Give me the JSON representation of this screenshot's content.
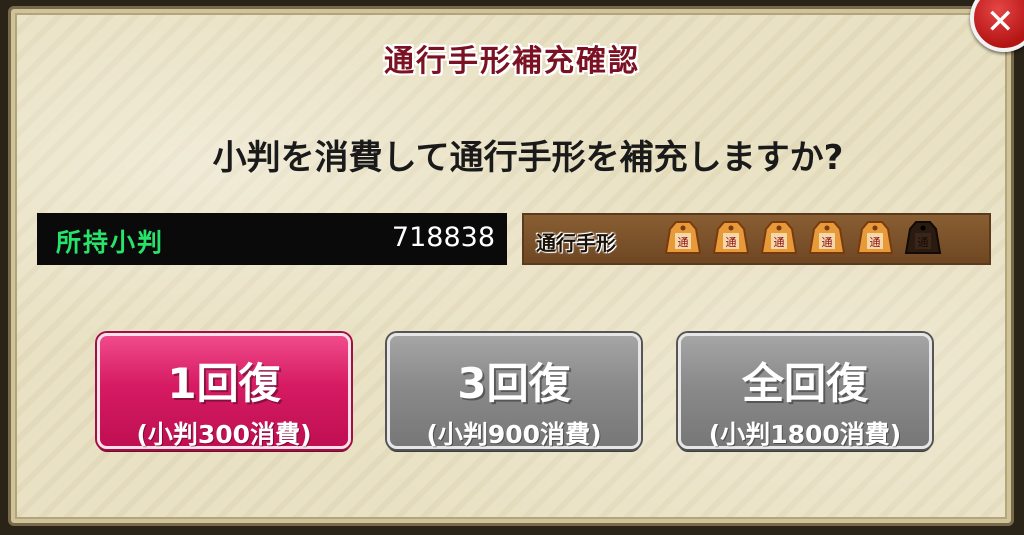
{
  "dialog": {
    "title": "通行手形補充確認",
    "question": "小判を消費して通行手形を補充しますか?",
    "koban": {
      "label": "所持小判",
      "value": "718838"
    },
    "pass": {
      "label": "通行手形",
      "icons": [
        {
          "state": "filled",
          "glyph": "通"
        },
        {
          "state": "filled",
          "glyph": "通"
        },
        {
          "state": "filled",
          "glyph": "通"
        },
        {
          "state": "filled",
          "glyph": "通"
        },
        {
          "state": "filled",
          "glyph": "通"
        },
        {
          "state": "empty",
          "glyph": "通"
        }
      ],
      "filled_count": 5,
      "total_count": 6
    },
    "buttons": [
      {
        "main": "1回復",
        "sub": "(小判300消費)",
        "color": "#d61b63"
      },
      {
        "main": "3回復",
        "sub": "(小判900消費)",
        "color": "#8a8a8a"
      },
      {
        "main": "全回復",
        "sub": "(小判1800消費)",
        "color": "#8a8a8a"
      }
    ],
    "close_icon": "close-icon"
  },
  "colors": {
    "title": "#7a1224",
    "koban_label": "#27e36a",
    "panel_bg": "#e9e1c3"
  }
}
